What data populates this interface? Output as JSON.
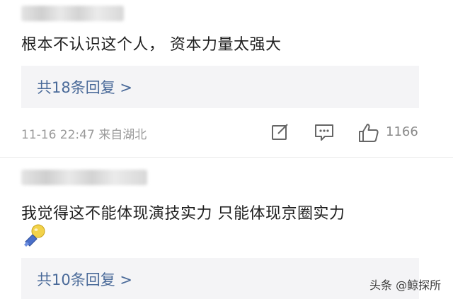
{
  "comment1": {
    "text": "根本不认识这个人， 资本力量太强大",
    "reply_label": "共18条回复 >",
    "timestamp": "11-16 22:47 来自湖北",
    "like_count": "1166"
  },
  "comment2": {
    "text": "我觉得这不能体现演技实力 只能体现京圈实力",
    "emoji": "doge-emoji",
    "reply_label": "共10条回复 >"
  },
  "watermark": "头条 @鲸探所",
  "icons": [
    "edit-icon",
    "comment-icon",
    "thumbs-up-icon"
  ],
  "colors": {
    "link": "#4a6a99",
    "meta": "#9a9a9a",
    "reply_bg": "#f4f4f6"
  }
}
